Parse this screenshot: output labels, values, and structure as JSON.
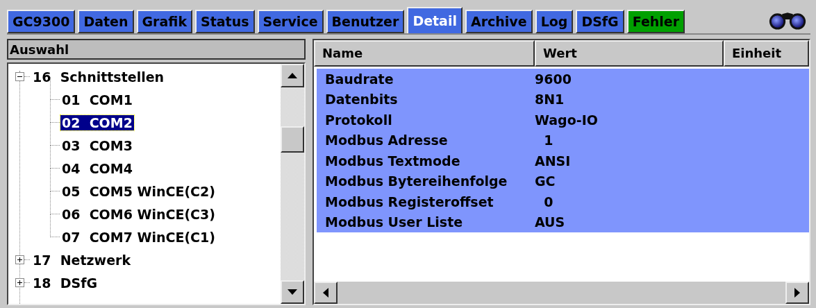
{
  "tabs": [
    {
      "label": "GC9300",
      "selected": false,
      "color": "#4169e1"
    },
    {
      "label": "Daten",
      "selected": false,
      "color": "#4169e1"
    },
    {
      "label": "Grafik",
      "selected": false,
      "color": "#4169e1"
    },
    {
      "label": "Status",
      "selected": false,
      "color": "#4169e1"
    },
    {
      "label": "Service",
      "selected": false,
      "color": "#4169e1"
    },
    {
      "label": "Benutzer",
      "selected": false,
      "color": "#4169e1"
    },
    {
      "label": "Detail",
      "selected": true,
      "color": "#4169e1"
    },
    {
      "label": "Archive",
      "selected": false,
      "color": "#4169e1"
    },
    {
      "label": "Log",
      "selected": false,
      "color": "#4169e1"
    },
    {
      "label": "DSfG",
      "selected": false,
      "color": "#4169e1"
    },
    {
      "label": "Fehler",
      "selected": false,
      "color": "#00a000"
    }
  ],
  "tree": {
    "title": "Auswahl",
    "items": [
      {
        "label": "16  Schnittstellen",
        "expanded": true,
        "selected": false,
        "children": [
          {
            "label": "01  COM1",
            "selected": false
          },
          {
            "label": "02  COM2",
            "selected": true
          },
          {
            "label": "03  COM3",
            "selected": false
          },
          {
            "label": "04  COM4",
            "selected": false
          },
          {
            "label": "05  COM5 WinCE(C2)",
            "selected": false
          },
          {
            "label": "06  COM6 WinCE(C3)",
            "selected": false
          },
          {
            "label": "07  COM7 WinCE(C1)",
            "selected": false
          }
        ]
      },
      {
        "label": "17  Netzwerk",
        "expanded": false,
        "selected": false
      },
      {
        "label": "18  DSfG",
        "expanded": false,
        "selected": false
      }
    ]
  },
  "table": {
    "columns": [
      "Name",
      "Wert",
      "Einheit"
    ],
    "rows": [
      {
        "name": "Baudrate",
        "value": "9600",
        "selected": true
      },
      {
        "name": "Datenbits",
        "value": "8N1",
        "selected": true
      },
      {
        "name": "Protokoll",
        "value": "Wago-IO",
        "selected": true
      },
      {
        "name": "Modbus Adresse",
        "value": "  1",
        "selected": true
      },
      {
        "name": "Modbus Textmode",
        "value": "ANSI",
        "selected": true
      },
      {
        "name": "Modbus Bytereihenfolge",
        "value": "GC",
        "selected": true
      },
      {
        "name": "Modbus Registeroffset",
        "value": "  0",
        "selected": true
      },
      {
        "name": "Modbus User Liste",
        "value": "AUS",
        "selected": true
      }
    ]
  }
}
